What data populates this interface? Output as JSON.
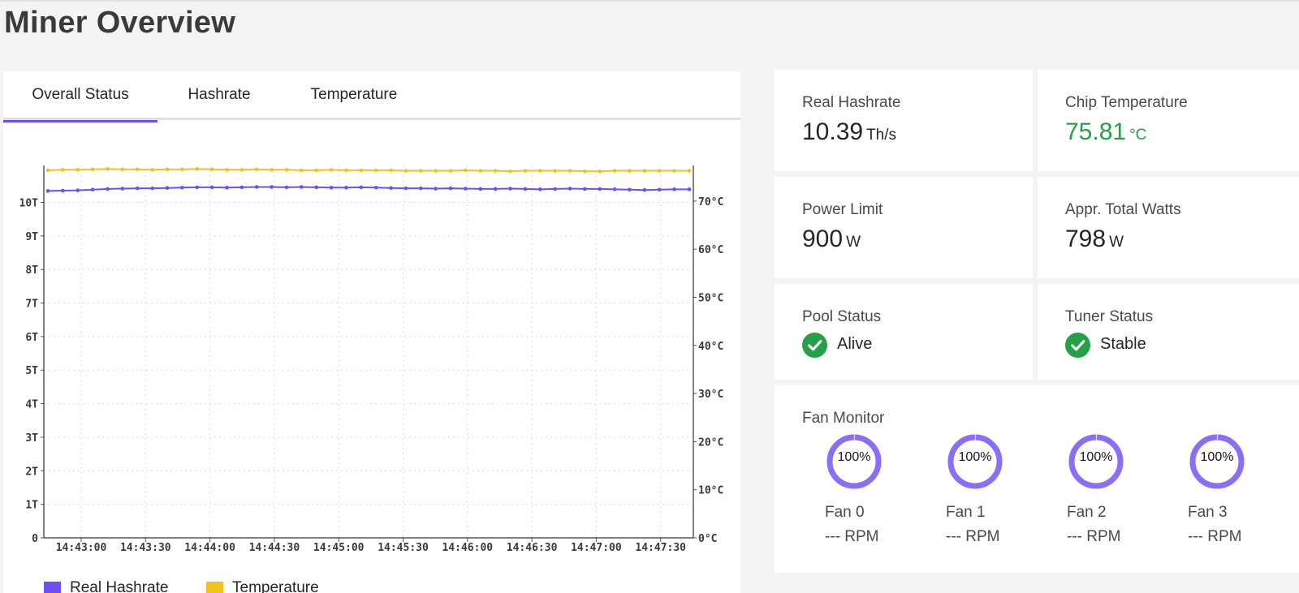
{
  "page": {
    "title": "Miner Overview"
  },
  "tabs": [
    {
      "label": "Overall Status",
      "active": true
    },
    {
      "label": "Hashrate",
      "active": false
    },
    {
      "label": "Temperature",
      "active": false
    }
  ],
  "chart_data": {
    "type": "line",
    "title": "",
    "x": [
      "14:43:00",
      "14:43:30",
      "14:44:00",
      "14:44:30",
      "14:45:00",
      "14:45:30",
      "14:46:00",
      "14:46:30",
      "14:47:00",
      "14:47:30"
    ],
    "y_left_ticks": [
      "0",
      "1T",
      "2T",
      "3T",
      "4T",
      "5T",
      "6T",
      "7T",
      "8T",
      "9T",
      "10T"
    ],
    "y_right_ticks": [
      "0°C",
      "10°C",
      "20°C",
      "30°C",
      "40°C",
      "50°C",
      "60°C",
      "70°C"
    ],
    "ylim_left": [
      0,
      11.1
    ],
    "ylim_right": [
      0,
      77.4
    ],
    "grid": true,
    "legend_position": "bottom-left",
    "series": [
      {
        "name": "Real Hashrate",
        "axis": "left",
        "color": "#6f4df7",
        "values": [
          10.34,
          10.35,
          10.36,
          10.38,
          10.4,
          10.41,
          10.42,
          10.42,
          10.43,
          10.44,
          10.45,
          10.45,
          10.44,
          10.45,
          10.46,
          10.46,
          10.45,
          10.46,
          10.45,
          10.44,
          10.44,
          10.45,
          10.44,
          10.43,
          10.42,
          10.42,
          10.41,
          10.42,
          10.41,
          10.4,
          10.4,
          10.41,
          10.4,
          10.39,
          10.4,
          10.41,
          10.4,
          10.4,
          10.39,
          10.38,
          10.37,
          10.38,
          10.39,
          10.39
        ]
      },
      {
        "name": "Temperature",
        "axis": "right",
        "color": "#f1c21b",
        "values": [
          76.4,
          76.5,
          76.5,
          76.6,
          76.7,
          76.6,
          76.6,
          76.5,
          76.6,
          76.6,
          76.7,
          76.6,
          76.5,
          76.5,
          76.6,
          76.5,
          76.5,
          76.4,
          76.4,
          76.5,
          76.4,
          76.4,
          76.4,
          76.4,
          76.3,
          76.3,
          76.3,
          76.3,
          76.4,
          76.3,
          76.3,
          76.2,
          76.3,
          76.3,
          76.3,
          76.3,
          76.2,
          76.2,
          76.3,
          76.3,
          76.3,
          76.3,
          76.3,
          76.3
        ]
      }
    ]
  },
  "legend": [
    {
      "label": "Real Hashrate",
      "color": "#6f4df7"
    },
    {
      "label": "Temperature",
      "color": "#f1c21b"
    }
  ],
  "cards": {
    "real_hashrate": {
      "label": "Real Hashrate",
      "value": "10.39",
      "unit": "Th/s"
    },
    "chip_temperature": {
      "label": "Chip Temperature",
      "value": "75.81",
      "unit": "°C",
      "color": "#24a148"
    },
    "power_limit": {
      "label": "Power Limit",
      "value": "900",
      "unit": "W"
    },
    "total_watts": {
      "label": "Appr. Total Watts",
      "value": "798",
      "unit": "W"
    },
    "pool_status": {
      "label": "Pool Status",
      "value": "Alive",
      "icon": "check-circle-icon",
      "color": "#24a148"
    },
    "tuner_status": {
      "label": "Tuner Status",
      "value": "Stable",
      "icon": "check-circle-icon",
      "color": "#24a148"
    }
  },
  "fan_monitor": {
    "label": "Fan Monitor",
    "ring_color": "#8a6ef7",
    "fans": [
      {
        "name": "Fan 0",
        "percent": "100%",
        "level": 1.0,
        "rpm": "--- RPM"
      },
      {
        "name": "Fan 1",
        "percent": "100%",
        "level": 1.0,
        "rpm": "--- RPM"
      },
      {
        "name": "Fan 2",
        "percent": "100%",
        "level": 1.0,
        "rpm": "--- RPM"
      },
      {
        "name": "Fan 3",
        "percent": "100%",
        "level": 1.0,
        "rpm": "--- RPM"
      }
    ]
  }
}
